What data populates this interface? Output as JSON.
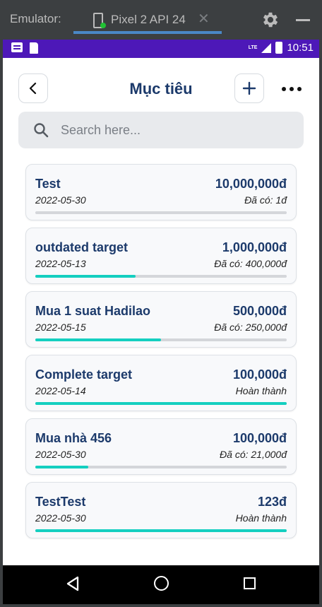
{
  "emulator": {
    "label": "Emulator:",
    "tab_label": "Pixel 2 API 24",
    "tab_close": "✕"
  },
  "status_bar": {
    "network": "LTE",
    "time": "10:51"
  },
  "header": {
    "title": "Mục tiêu",
    "back_icon": "chevron-left-icon",
    "add_icon": "plus-icon",
    "more_icon": "more-horizontal-icon"
  },
  "search": {
    "placeholder": "Search here..."
  },
  "targets": [
    {
      "name": "Test",
      "amount": "10,000,000đ",
      "date": "2022-05-30",
      "status": "Đã có: 1đ",
      "progress": 0.0
    },
    {
      "name": "outdated target",
      "amount": "1,000,000đ",
      "date": "2022-05-13",
      "status": "Đã có: 400,000đ",
      "progress": 0.4
    },
    {
      "name": "Mua 1 suat Hadilao",
      "amount": "500,000đ",
      "date": "2022-05-15",
      "status": "Đã có: 250,000đ",
      "progress": 0.5
    },
    {
      "name": "Complete target",
      "amount": "100,000đ",
      "date": "2022-05-14",
      "status": "Hoàn thành",
      "progress": 1.0
    },
    {
      "name": "Mua nhà 456",
      "amount": "100,000đ",
      "date": "2022-05-30",
      "status": "Đã có: 21,000đ",
      "progress": 0.21
    },
    {
      "name": "TestTest",
      "amount": "123đ",
      "date": "2022-05-30",
      "status": "Hoàn thành",
      "progress": 1.0
    }
  ],
  "colors": {
    "accent": "#14cfc0",
    "title": "#1c3a6b",
    "status_bar": "#4d18b8"
  }
}
